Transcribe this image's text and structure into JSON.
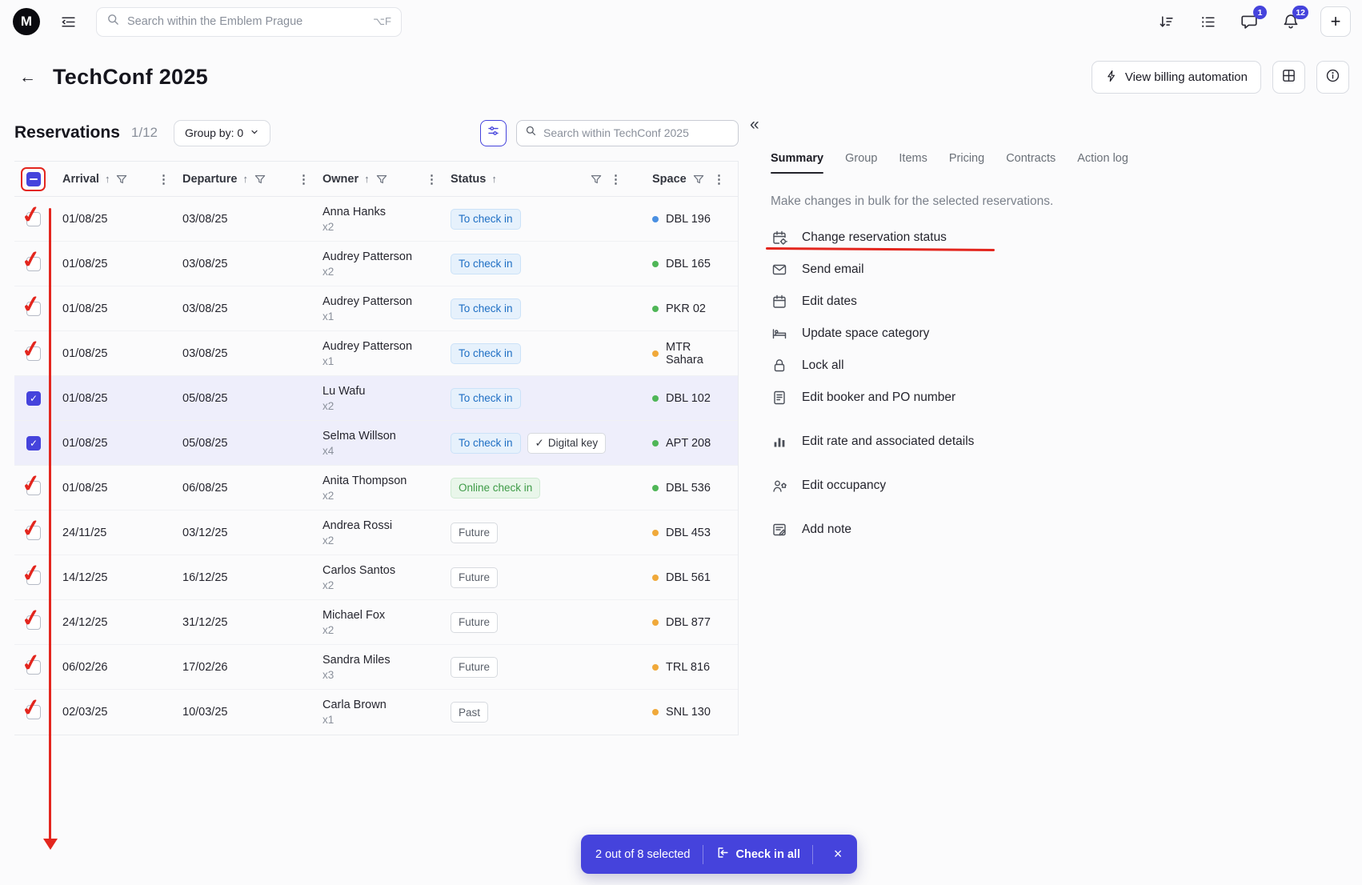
{
  "colors": {
    "accent": "#4543DC",
    "annotation_red": "#E3261E",
    "status_blue": "#1F6FC4",
    "status_green": "#3E9B47",
    "dot_blue": "#4A90E2",
    "dot_green": "#4FB657",
    "dot_yellow": "#F0A93A"
  },
  "icons": {
    "back": "←",
    "collapse_panel": "«",
    "close": "×",
    "kebab": "⋮",
    "sort_asc": "↑",
    "plus": "+",
    "check": "✓",
    "chevron_down": "⌄"
  },
  "topbar": {
    "search_placeholder": "Search within the Emblem Prague",
    "search_shortcut": "⌥F",
    "chat_badge": "1",
    "bell_badge": "12"
  },
  "page_header": {
    "title": "TechConf 2025",
    "billing_button_label": "View billing automation"
  },
  "toolbar": {
    "section_title": "Reservations",
    "count": "1/12",
    "group_by_label": "Group by: 0",
    "search_placeholder": "Search within TechConf 2025"
  },
  "table": {
    "columns": [
      {
        "label": "Arrival",
        "sort": true,
        "funnel_right": false
      },
      {
        "label": "Departure",
        "sort": true,
        "funnel_right": false
      },
      {
        "label": "Owner",
        "sort": true,
        "funnel_right": false
      },
      {
        "label": "Status",
        "sort": true,
        "funnel_right": true
      },
      {
        "label": "Space",
        "sort": false,
        "funnel_right": false
      }
    ],
    "rows": [
      {
        "arrival": "01/08/25",
        "departure": "03/08/25",
        "owner": "Anna Hanks",
        "pax": "x2",
        "status": "To check in",
        "status_type": "blue",
        "space": "DBL 196",
        "dot": "blue",
        "checked": false,
        "selected": false,
        "red_check": true
      },
      {
        "arrival": "01/08/25",
        "departure": "03/08/25",
        "owner": "Audrey Patterson",
        "pax": "x2",
        "status": "To check in",
        "status_type": "blue",
        "space": "DBL 165",
        "dot": "green",
        "checked": false,
        "selected": false,
        "red_check": true
      },
      {
        "arrival": "01/08/25",
        "departure": "03/08/25",
        "owner": "Audrey Patterson",
        "pax": "x1",
        "status": "To check in",
        "status_type": "blue",
        "space": "PKR 02",
        "dot": "green",
        "checked": false,
        "selected": false,
        "red_check": true
      },
      {
        "arrival": "01/08/25",
        "departure": "03/08/25",
        "owner": "Audrey Patterson",
        "pax": "x1",
        "status": "To check in",
        "status_type": "blue",
        "space": "MTR Sahara",
        "dot": "yellow",
        "checked": false,
        "selected": false,
        "red_check": true
      },
      {
        "arrival": "01/08/25",
        "departure": "05/08/25",
        "owner": "Lu Wafu",
        "pax": "x2",
        "status": "To check in",
        "status_type": "blue",
        "space": "DBL 102",
        "dot": "green",
        "checked": true,
        "selected": true,
        "red_check": false
      },
      {
        "arrival": "01/08/25",
        "departure": "05/08/25",
        "owner": "Selma Willson",
        "pax": "x4",
        "status": "To check in",
        "status_type": "blue",
        "digital_key": "Digital key",
        "space": "APT 208",
        "dot": "green",
        "checked": true,
        "selected": true,
        "red_check": false
      },
      {
        "arrival": "01/08/25",
        "departure": "06/08/25",
        "owner": "Anita Thompson",
        "pax": "x2",
        "status": "Online check in",
        "status_type": "green",
        "space": "DBL 536",
        "dot": "green",
        "checked": false,
        "selected": false,
        "red_check": true
      },
      {
        "arrival": "24/11/25",
        "departure": "03/12/25",
        "owner": "Andrea Rossi",
        "pax": "x2",
        "status": "Future",
        "status_type": "gray",
        "space": "DBL 453",
        "dot": "yellow",
        "checked": false,
        "selected": false,
        "red_check": true
      },
      {
        "arrival": "14/12/25",
        "departure": "16/12/25",
        "owner": "Carlos Santos",
        "pax": "x2",
        "status": "Future",
        "status_type": "gray",
        "space": "DBL 561",
        "dot": "yellow",
        "checked": false,
        "selected": false,
        "red_check": true
      },
      {
        "arrival": "24/12/25",
        "departure": "31/12/25",
        "owner": "Michael Fox",
        "pax": "x2",
        "status": "Future",
        "status_type": "gray",
        "space": "DBL 877",
        "dot": "yellow",
        "checked": false,
        "selected": false,
        "red_check": true
      },
      {
        "arrival": "06/02/26",
        "departure": "17/02/26",
        "owner": "Sandra Miles",
        "pax": "x3",
        "status": "Future",
        "status_type": "gray",
        "space": "TRL 816",
        "dot": "yellow",
        "checked": false,
        "selected": false,
        "red_check": true
      },
      {
        "arrival": "02/03/25",
        "departure": "10/03/25",
        "owner": "Carla Brown",
        "pax": "x1",
        "status": "Past",
        "status_type": "gray",
        "space": "SNL 130",
        "dot": "yellow",
        "checked": false,
        "selected": false,
        "red_check": true
      }
    ]
  },
  "panel": {
    "tabs": [
      "Summary",
      "Group",
      "Items",
      "Pricing",
      "Contracts",
      "Action log"
    ],
    "active_tab": "Summary",
    "description": "Make changes in bulk for the selected reservations.",
    "actions": [
      {
        "icon": "calendar-gear",
        "label": "Change reservation status",
        "annotated": true
      },
      {
        "icon": "envelope",
        "label": "Send email",
        "annotated": false
      },
      {
        "icon": "calendar",
        "label": "Edit dates",
        "annotated": false
      },
      {
        "icon": "bed",
        "label": "Update space category",
        "annotated": false
      },
      {
        "icon": "lock",
        "label": "Lock all",
        "annotated": false
      },
      {
        "icon": "document",
        "label": "Edit booker and PO number",
        "annotated": false
      },
      {
        "icon": "chart",
        "label": "Edit rate and associated details",
        "annotated": false
      },
      {
        "icon": "occupancy",
        "label": "Edit occupancy",
        "annotated": false
      },
      {
        "icon": "note",
        "label": "Add note",
        "annotated": false
      }
    ]
  },
  "bottom_bar": {
    "selected_text": "2 out of 8 selected",
    "action_label": "Check in all"
  },
  "annotations": {
    "header_checkbox_boxed": true,
    "vertical_arrow": true,
    "underlined_action": "Change reservation status"
  }
}
